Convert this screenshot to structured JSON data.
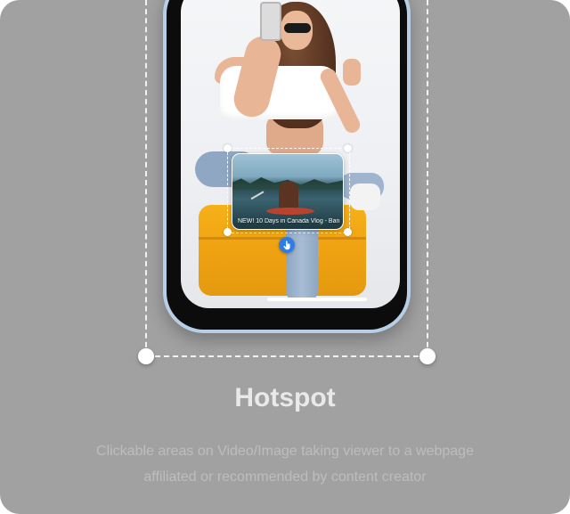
{
  "card": {
    "title": "Hotspot",
    "description": "Clickable areas on Video/Image taking viewer to a webpage affiliated or recommended by content creator"
  },
  "hotspot": {
    "video_title": "NEW! 10 Days in Canada Vlog - Banff...",
    "tap_icon": "hand-pointer-icon"
  },
  "colors": {
    "card_background": "#a1a1a1",
    "accent_blue": "#2f7de1",
    "phone_frame": "#b7cfe6"
  }
}
